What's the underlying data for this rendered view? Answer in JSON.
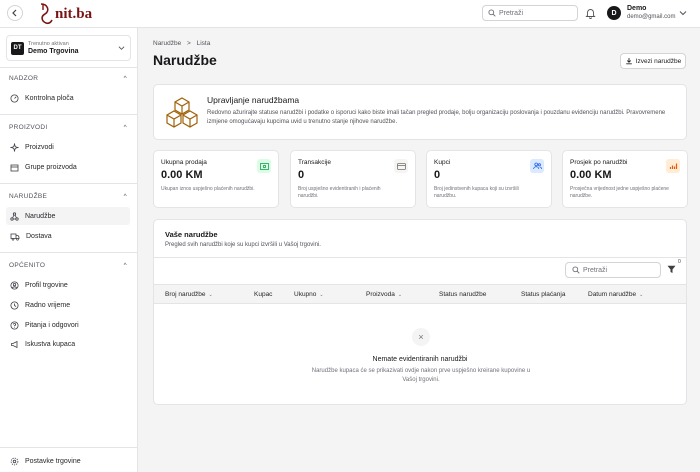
{
  "topbar": {
    "logo_text": "nit.ba",
    "search_placeholder": "Pretraži",
    "user_initial": "D",
    "user_name": "Demo",
    "user_email": "demo@gmail.com"
  },
  "sidebar": {
    "store_initials": "DT",
    "store_caption": "Trenutno aktivan",
    "store_name": "Demo Trgovina",
    "sections": [
      {
        "title": "NADZOR",
        "items": [
          {
            "label": "Kontrolna ploča"
          }
        ]
      },
      {
        "title": "PROIZVODI",
        "items": [
          {
            "label": "Proizvodi"
          },
          {
            "label": "Grupe proizvoda"
          }
        ]
      },
      {
        "title": "NARUDŽBE",
        "items": [
          {
            "label": "Narudžbe"
          },
          {
            "label": "Dostava"
          }
        ]
      },
      {
        "title": "OPĆENITO",
        "items": [
          {
            "label": "Profil trgovine"
          },
          {
            "label": "Radno vrijeme"
          },
          {
            "label": "Pitanja i odgovori"
          },
          {
            "label": "Iskustva kupaca"
          }
        ]
      }
    ],
    "bottom_item": "Postavke trgovine"
  },
  "main": {
    "breadcrumb_root": "Narudžbe",
    "breadcrumb_sep": ">",
    "breadcrumb_current": "Lista",
    "title": "Narudžbe",
    "export_label": "Izvezi narudžbe",
    "info_title": "Upravljanje narudžbama",
    "info_desc": "Redovno ažurirajte statuse narudžbi i podatke o isporuci kako biste imali tačan pregled prodaje, bolju organizaciju poslovanja i pouzdanu evidenciju narudžbi. Pravovremene izmjene omogućavaju kupcima uvid u trenutno stanje njihove narudžbe.",
    "stats": [
      {
        "label": "Ukupna prodaja",
        "value": "0.00 KM",
        "desc": "Ukupan iznos uspješno plaćenih narudžbi.",
        "icon": "money-icon",
        "color": "#16a34a",
        "bg": "#dcfce7"
      },
      {
        "label": "Transakcije",
        "value": "0",
        "desc": "Broj uspješno evidentiranih i plaćenih narudžbi.",
        "icon": "card-icon",
        "color": "#78716c",
        "bg": "#f5f5f4"
      },
      {
        "label": "Kupci",
        "value": "0",
        "desc": "Broj jedinstvenih kupaca koji su izvršili narudžbu.",
        "icon": "users-icon",
        "color": "#2563eb",
        "bg": "#dbeafe"
      },
      {
        "label": "Prosjek po narudžbi",
        "value": "0.00 KM",
        "desc": "Prosječna vrijednost jedne uspješno plaćene narudžbe.",
        "icon": "chart-icon",
        "color": "#ea580c",
        "bg": "#ffedd5"
      }
    ],
    "orders": {
      "title": "Vaše narudžbe",
      "subtitle": "Pregled svih narudžbi koje su kupci izvršili u Vašoj trgovini.",
      "search_placeholder": "Pretraži",
      "filter_count": "0",
      "columns": [
        "Broj narudžbe",
        "Kupac",
        "Ukupno",
        "Proizvoda",
        "Status narudžbe",
        "Status plaćanja",
        "Datum narudžbe"
      ],
      "empty_title": "Nemate evidentiranih narudžbi",
      "empty_desc": "Narudžbe kupaca će se prikazivati ovdje nakon prve uspješno kreirane kupovine u Vašoj trgovini."
    }
  }
}
